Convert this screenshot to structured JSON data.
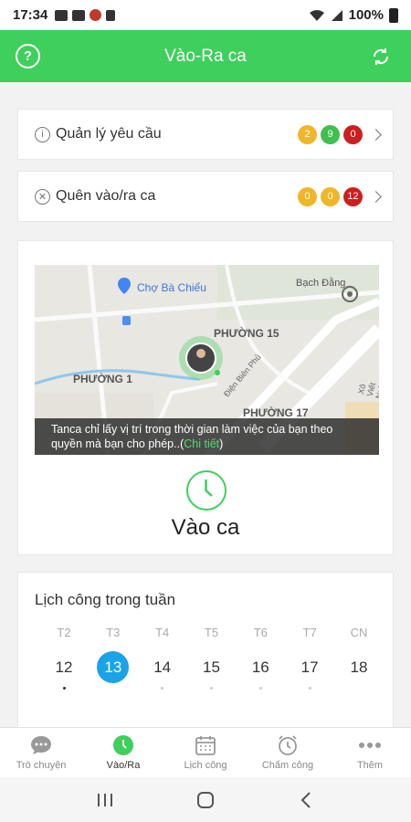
{
  "status_bar": {
    "time": "17:34",
    "battery": "100%"
  },
  "header": {
    "title": "Vào-Ra ca"
  },
  "requests": {
    "label": "Quản lý yêu cầu",
    "badges": [
      "2",
      "9",
      "0"
    ]
  },
  "forgot": {
    "label": "Quên vào/ra ca",
    "badges": [
      "0",
      "0",
      "12"
    ]
  },
  "map": {
    "labels": {
      "cho_ba_chieu": "Chợ Bà Chiểu",
      "bach_dang": "Bạch Đằng",
      "phuong_15": "PHƯỜNG 15",
      "phuong_1": "PHƯỜNG 1",
      "phuong_17": "PHƯỜNG 17",
      "dien_bien_phu": "Điện Biên Phủ",
      "xo_viet": "Xô Viết Nghệ Tĩnh"
    },
    "caption": "Tanca chỉ lấy vị trí trong thời gian làm việc của bạn theo quyền mà bạn cho phép..(",
    "caption_link": "Chi tiết",
    "caption_end": ")"
  },
  "checkin": {
    "label": "Vào ca"
  },
  "week": {
    "title": "Lịch công trong tuần",
    "days": [
      {
        "name": "T2",
        "date": "12"
      },
      {
        "name": "T3",
        "date": "13"
      },
      {
        "name": "T4",
        "date": "14"
      },
      {
        "name": "T5",
        "date": "15"
      },
      {
        "name": "T6",
        "date": "16"
      },
      {
        "name": "T7",
        "date": "17"
      },
      {
        "name": "CN",
        "date": "18"
      }
    ]
  },
  "bottom_nav": [
    {
      "label": "Trò chuyện",
      "icon": "chat-icon"
    },
    {
      "label": "Vào/Ra",
      "icon": "clock-icon"
    },
    {
      "label": "Lịch công",
      "icon": "calendar-icon"
    },
    {
      "label": "Chấm công",
      "icon": "alarm-clock-icon"
    },
    {
      "label": "Thêm",
      "icon": "more-icon"
    }
  ],
  "colors": {
    "primary": "#3fcf5c",
    "active_day": "#1ba3e6",
    "badge_yellow": "#f0b62a",
    "badge_green": "#3fbf4f",
    "badge_red": "#cc1f1f"
  }
}
